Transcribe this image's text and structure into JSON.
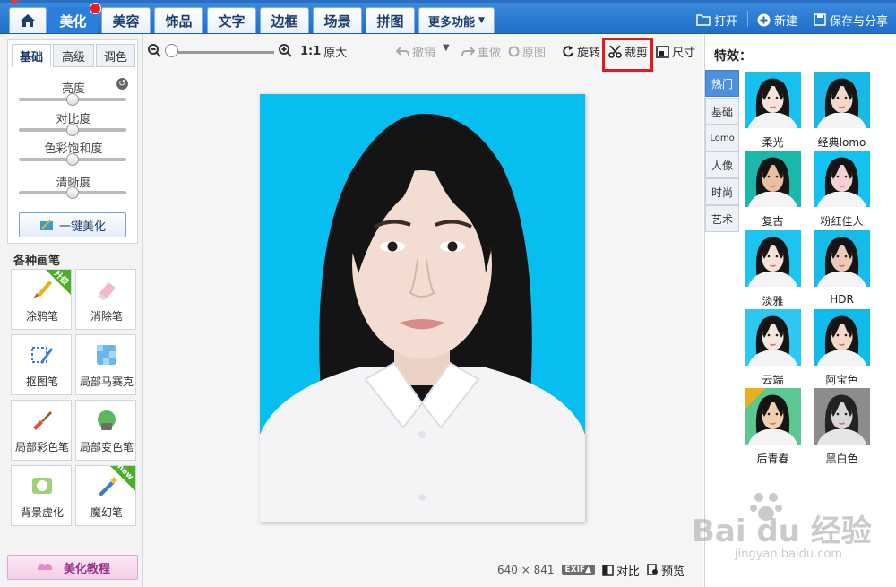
{
  "nav": {
    "tabs": [
      "美化",
      "美容",
      "饰品",
      "文字",
      "边框",
      "场景",
      "拼图",
      "更多功能"
    ],
    "actions": {
      "open": "打开",
      "new": "新建",
      "save_share": "保存与分享"
    }
  },
  "left_panel": {
    "subtabs": [
      "基础",
      "高级",
      "调色"
    ],
    "sliders": [
      {
        "label": "亮度",
        "value": 0.5
      },
      {
        "label": "对比度",
        "value": 0.5
      },
      {
        "label": "色彩饱和度",
        "value": 0.5
      },
      {
        "label": "清晰度",
        "value": 0.5
      }
    ],
    "one_key_label": "一键美化",
    "pens_title": "各种画笔",
    "pens": [
      {
        "label": "涂鸦笔",
        "badge": "升级"
      },
      {
        "label": "消除笔",
        "badge": ""
      },
      {
        "label": "抠图笔",
        "badge": ""
      },
      {
        "label": "局部马赛克",
        "badge": ""
      },
      {
        "label": "局部彩色笔",
        "badge": ""
      },
      {
        "label": "局部变色笔",
        "badge": ""
      },
      {
        "label": "背景虚化",
        "badge": ""
      },
      {
        "label": "魔幻笔",
        "badge": "new"
      }
    ],
    "tutorial_label": "美化教程"
  },
  "toolbar": {
    "ratio": "1:1",
    "original_size": "原大",
    "undo": "撤销",
    "redo": "重做",
    "original": "原图",
    "rotate": "旋转",
    "crop": "裁剪",
    "size": "尺寸"
  },
  "status": {
    "dimensions": "640 × 841",
    "exif": "EXIF▲",
    "compare": "对比",
    "preview": "预览"
  },
  "right_panel": {
    "title": "特效：",
    "categories": [
      "热门",
      "基础",
      "Lomo",
      "人像",
      "时尚",
      "艺术"
    ],
    "effects": [
      {
        "name": "柔光"
      },
      {
        "name": "经典lomo"
      },
      {
        "name": "复古"
      },
      {
        "name": "粉红佳人"
      },
      {
        "name": "淡雅"
      },
      {
        "name": "HDR"
      },
      {
        "name": "云端"
      },
      {
        "name": "阿宝色"
      },
      {
        "name": "后青春"
      },
      {
        "name": "黑白色"
      }
    ]
  },
  "watermark": {
    "main": "Bai du 经验",
    "sub": "jingyan.baidu.com"
  },
  "colors": {
    "accent": "#2b7fdc",
    "photo_bg": "#06bff0",
    "highlight": "#e41919"
  }
}
